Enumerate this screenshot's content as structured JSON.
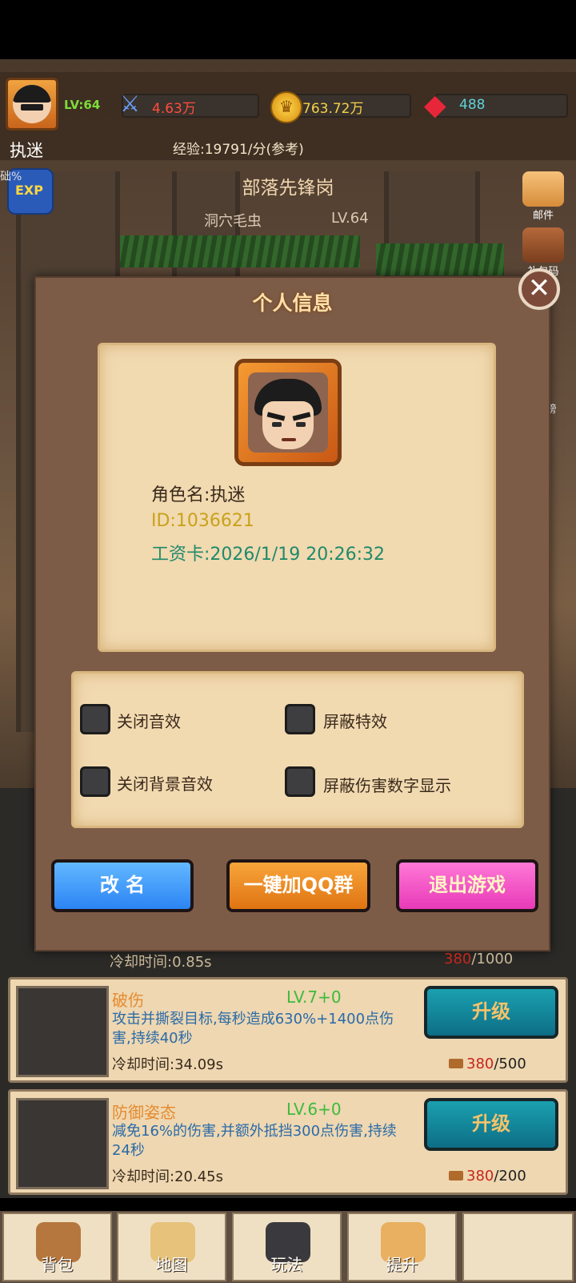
{
  "header": {
    "player_name": "执迷",
    "player_level": "LV:64",
    "power": "4.63万",
    "gold": "763.72万",
    "gems": "488",
    "exp_rate": "经验:19791/分(参考)",
    "exp_percent": "础%",
    "exp_badge": "EXP"
  },
  "stage": {
    "name": "部落先锋岗",
    "enemy_name": "洞穴毛虫",
    "enemy_level": "LV.64"
  },
  "side_buttons": [
    "邮件",
    "礼包码",
    "榜"
  ],
  "profile_modal": {
    "title": "个人信息",
    "close_icon": "close-icon",
    "role_name": "角色名:执迷",
    "id": "ID:1036621",
    "pay_card": "工资卡:2026/1/19 20:26:32",
    "options": [
      "关闭音效",
      "屏蔽特效",
      "关闭背景音效",
      "屏蔽伤害数字显示"
    ],
    "buttons": {
      "rename": "改 名",
      "join_qq": "一键加QQ群",
      "exit": "退出游戏"
    }
  },
  "skills_peek": {
    "cooldown": "冷却时间:0.85s",
    "cost": "380",
    "cost_max": "/1000"
  },
  "skills": [
    {
      "name": "破伤",
      "level": "LV.7+0",
      "desc": "攻击并撕裂目标,每秒造成630%+1400点伤害,持续40秒",
      "cooldown": "冷却时间:34.09s",
      "upgrade": "升级",
      "cost": "380",
      "cost_max": "/500"
    },
    {
      "name": "防御姿态",
      "level": "LV.6+0",
      "desc": "减免16%的伤害,并额外抵挡300点伤害,持续24秒",
      "cooldown": "冷却时间:20.45s",
      "upgrade": "升级",
      "cost": "380",
      "cost_max": "/200"
    }
  ],
  "nav": [
    "背包",
    "地图",
    "玩法",
    "提升"
  ],
  "colors": {
    "accent_gold": "#ffe0a8",
    "info_gold": "#c9a21a",
    "info_teal": "#1f8a6a",
    "upgrade_teal": "#0d6e86"
  }
}
